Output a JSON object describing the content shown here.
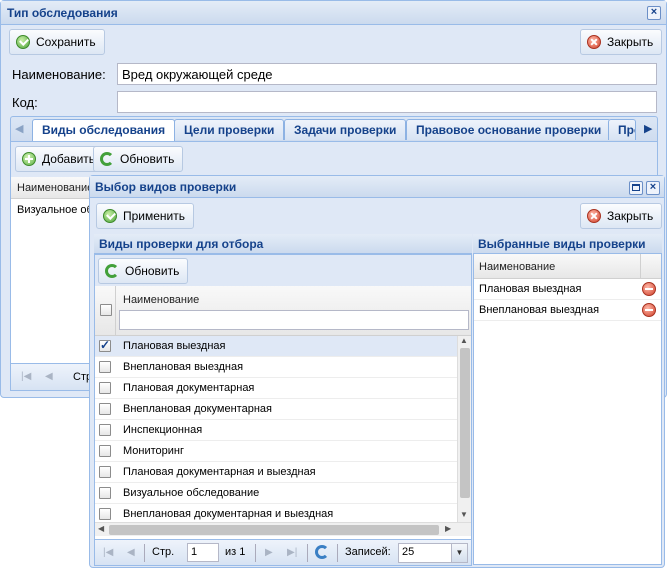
{
  "main_window": {
    "title": "Тип обследования",
    "save_label": "Сохранить",
    "close_label": "Закрыть",
    "name_label": "Наименование:",
    "name_value": "Вред окружающей среде",
    "code_label": "Код:",
    "code_value": "",
    "tabs": [
      "Виды обследования",
      "Цели проверки",
      "Задачи проверки",
      "Правовое основание проверки",
      "Пре"
    ],
    "add_label": "Добавить",
    "refresh_label": "Обновить",
    "grid_header": "Наименование",
    "grid_rows": [
      "Визуальное об"
    ],
    "pager_page_label": "Стр."
  },
  "dialog": {
    "title": "Выбор видов проверки",
    "apply_label": "Применить",
    "close_label": "Закрыть",
    "left_section": "Виды проверки для отбора",
    "right_section": "Выбранные виды проверки",
    "refresh_label": "Обновить",
    "left_header": "Наименование",
    "filter_value": "",
    "left_rows": [
      {
        "label": "Плановая выездная",
        "checked": true
      },
      {
        "label": "Внеплановая выездная",
        "checked": false
      },
      {
        "label": "Плановая документарная",
        "checked": false
      },
      {
        "label": "Внеплановая документарная",
        "checked": false
      },
      {
        "label": "Инспекционная",
        "checked": false
      },
      {
        "label": "Мониторинг",
        "checked": false
      },
      {
        "label": "Плановая документарная и выездная",
        "checked": false
      },
      {
        "label": "Визуальное обследование",
        "checked": false
      },
      {
        "label": "Внеплановая документарная и выездная",
        "checked": false
      }
    ],
    "right_header": "Наименование",
    "right_rows": [
      "Плановая выездная",
      "Внеплановая выездная"
    ],
    "pager": {
      "page_label": "Стр.",
      "page_value": "1",
      "of_label": "из 1",
      "records_label": "Записей:",
      "records_value": "25"
    }
  }
}
